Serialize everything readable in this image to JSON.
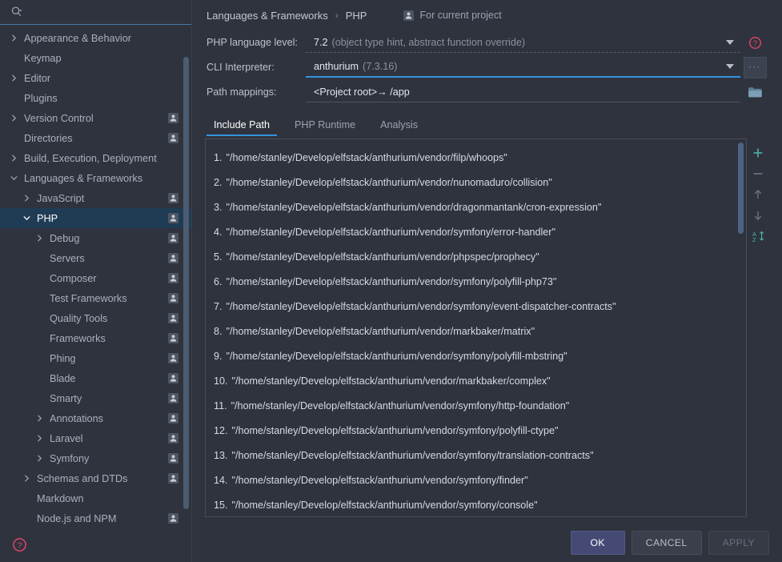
{
  "search": {
    "icon": "search-icon",
    "placeholder": ""
  },
  "sidebar": {
    "items": [
      {
        "label": "Appearance & Behavior",
        "indent": 0,
        "arrow": "right",
        "badge": false,
        "selected": false
      },
      {
        "label": "Keymap",
        "indent": 0,
        "arrow": "none",
        "badge": false,
        "selected": false
      },
      {
        "label": "Editor",
        "indent": 0,
        "arrow": "right",
        "badge": false,
        "selected": false
      },
      {
        "label": "Plugins",
        "indent": 0,
        "arrow": "none",
        "badge": false,
        "selected": false
      },
      {
        "label": "Version Control",
        "indent": 0,
        "arrow": "right",
        "badge": true,
        "selected": false
      },
      {
        "label": "Directories",
        "indent": 0,
        "arrow": "none",
        "badge": true,
        "selected": false
      },
      {
        "label": "Build, Execution, Deployment",
        "indent": 0,
        "arrow": "right",
        "badge": false,
        "selected": false
      },
      {
        "label": "Languages & Frameworks",
        "indent": 0,
        "arrow": "down",
        "badge": false,
        "selected": false
      },
      {
        "label": "JavaScript",
        "indent": 1,
        "arrow": "right",
        "badge": true,
        "selected": false
      },
      {
        "label": "PHP",
        "indent": 1,
        "arrow": "down",
        "badge": true,
        "selected": true
      },
      {
        "label": "Debug",
        "indent": 2,
        "arrow": "right",
        "badge": true,
        "selected": false
      },
      {
        "label": "Servers",
        "indent": 2,
        "arrow": "none",
        "badge": true,
        "selected": false
      },
      {
        "label": "Composer",
        "indent": 2,
        "arrow": "none",
        "badge": true,
        "selected": false
      },
      {
        "label": "Test Frameworks",
        "indent": 2,
        "arrow": "none",
        "badge": true,
        "selected": false
      },
      {
        "label": "Quality Tools",
        "indent": 2,
        "arrow": "none",
        "badge": true,
        "selected": false
      },
      {
        "label": "Frameworks",
        "indent": 2,
        "arrow": "none",
        "badge": true,
        "selected": false
      },
      {
        "label": "Phing",
        "indent": 2,
        "arrow": "none",
        "badge": true,
        "selected": false
      },
      {
        "label": "Blade",
        "indent": 2,
        "arrow": "none",
        "badge": true,
        "selected": false
      },
      {
        "label": "Smarty",
        "indent": 2,
        "arrow": "none",
        "badge": true,
        "selected": false
      },
      {
        "label": "Annotations",
        "indent": 2,
        "arrow": "right",
        "badge": true,
        "selected": false
      },
      {
        "label": "Laravel",
        "indent": 2,
        "arrow": "right",
        "badge": true,
        "selected": false
      },
      {
        "label": "Symfony",
        "indent": 2,
        "arrow": "right",
        "badge": true,
        "selected": false
      },
      {
        "label": "Schemas and DTDs",
        "indent": 1,
        "arrow": "right",
        "badge": true,
        "selected": false
      },
      {
        "label": "Markdown",
        "indent": 1,
        "arrow": "none",
        "badge": false,
        "selected": false
      },
      {
        "label": "Node.js and NPM",
        "indent": 1,
        "arrow": "none",
        "badge": true,
        "selected": false
      }
    ],
    "help_icon": "help-circle-icon"
  },
  "breadcrumb": {
    "root": "Languages & Frameworks",
    "separator": "›",
    "current": "PHP",
    "scope_badge_icon": "project-user-icon",
    "scope_label": "For current project"
  },
  "fields": {
    "language_level": {
      "label": "PHP language level:",
      "value_main": "7.2",
      "value_hint": "(object type hint, abstract function override)",
      "help_icon": "help-circle-icon"
    },
    "cli_interpreter": {
      "label": "CLI Interpreter:",
      "value_main": "anthurium",
      "value_hint": "(7.3.16)",
      "browse_label": "···"
    },
    "path_mappings": {
      "label": "Path mappings:",
      "value": "<Project root>→ /app",
      "folder_icon": "folder-icon"
    }
  },
  "tabs": [
    {
      "label": "Include Path",
      "active": true
    },
    {
      "label": "PHP Runtime",
      "active": false
    },
    {
      "label": "Analysis",
      "active": false
    }
  ],
  "include_path": {
    "entries": [
      {
        "index": "1.",
        "path": "\"/home/stanley/Develop/elfstack/anthurium/vendor/filp/whoops\""
      },
      {
        "index": "2.",
        "path": "\"/home/stanley/Develop/elfstack/anthurium/vendor/nunomaduro/collision\""
      },
      {
        "index": "3.",
        "path": "\"/home/stanley/Develop/elfstack/anthurium/vendor/dragonmantank/cron-expression\""
      },
      {
        "index": "4.",
        "path": "\"/home/stanley/Develop/elfstack/anthurium/vendor/symfony/error-handler\""
      },
      {
        "index": "5.",
        "path": "\"/home/stanley/Develop/elfstack/anthurium/vendor/phpspec/prophecy\""
      },
      {
        "index": "6.",
        "path": "\"/home/stanley/Develop/elfstack/anthurium/vendor/symfony/polyfill-php73\""
      },
      {
        "index": "7.",
        "path": "\"/home/stanley/Develop/elfstack/anthurium/vendor/symfony/event-dispatcher-contracts\""
      },
      {
        "index": "8.",
        "path": "\"/home/stanley/Develop/elfstack/anthurium/vendor/markbaker/matrix\""
      },
      {
        "index": "9.",
        "path": "\"/home/stanley/Develop/elfstack/anthurium/vendor/symfony/polyfill-mbstring\""
      },
      {
        "index": "10.",
        "path": "\"/home/stanley/Develop/elfstack/anthurium/vendor/markbaker/complex\""
      },
      {
        "index": "11.",
        "path": "\"/home/stanley/Develop/elfstack/anthurium/vendor/symfony/http-foundation\""
      },
      {
        "index": "12.",
        "path": "\"/home/stanley/Develop/elfstack/anthurium/vendor/symfony/polyfill-ctype\""
      },
      {
        "index": "13.",
        "path": "\"/home/stanley/Develop/elfstack/anthurium/vendor/symfony/translation-contracts\""
      },
      {
        "index": "14.",
        "path": "\"/home/stanley/Develop/elfstack/anthurium/vendor/symfony/finder\""
      },
      {
        "index": "15.",
        "path": "\"/home/stanley/Develop/elfstack/anthurium/vendor/symfony/console\""
      }
    ],
    "toolbar": [
      {
        "name": "add-button",
        "icon": "plus-icon",
        "enabled": true
      },
      {
        "name": "remove-button",
        "icon": "minus-icon",
        "enabled": false
      },
      {
        "name": "move-up-button",
        "icon": "arrow-up-icon",
        "enabled": false
      },
      {
        "name": "move-down-button",
        "icon": "arrow-down-icon",
        "enabled": false
      },
      {
        "name": "sort-button",
        "icon": "sort-az-icon",
        "enabled": true
      }
    ]
  },
  "footer": {
    "ok": "OK",
    "cancel": "CANCEL",
    "apply": "APPLY"
  },
  "colors": {
    "background": "#2f333d",
    "accent": "#3592e0",
    "selection": "#1f3c55",
    "teal": "#4fb3ac",
    "ok_button": "#454a75",
    "help_red": "#e0456b"
  }
}
